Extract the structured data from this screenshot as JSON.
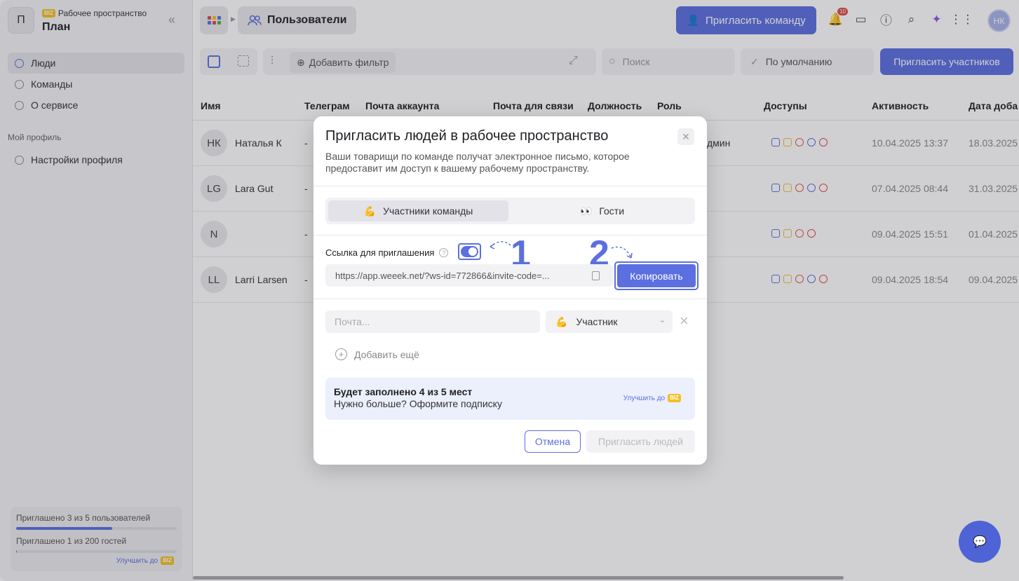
{
  "sidebar": {
    "workspace_avatar": "П",
    "workspace_badge": "BIZ",
    "workspace_label": "Рабочее пространство",
    "workspace_name": "План",
    "items": [
      {
        "label": "Люди",
        "icon": "smile-icon",
        "active": true
      },
      {
        "label": "Команды",
        "icon": "team-icon",
        "active": false
      },
      {
        "label": "О сервисе",
        "icon": "help-icon",
        "active": false
      }
    ],
    "section_title": "Мой профиль",
    "profile_item": "Настройки профиля",
    "usage": {
      "users_text": "Приглашено 3 из 5 пользователей",
      "users_fraction": 0.6,
      "guests_text": "Приглашено 1 из 200 гостей",
      "guests_fraction": 0.005,
      "upgrade_label": "Улучшить до",
      "upgrade_badge": "BIZ"
    }
  },
  "header": {
    "breadcrumb": "Пользователи",
    "invite_team": "Пригласить команду",
    "notifications_count": "10",
    "user_initials": "НК"
  },
  "toolbar": {
    "add_filter": "Добавить фильтр",
    "search_placeholder": "Поиск",
    "sort": "По умолчанию",
    "invite_members": "Пригласить участников"
  },
  "table": {
    "columns": [
      "Имя",
      "Телеграм",
      "Почта аккаунта",
      "Почта для связи",
      "Должность",
      "Роль",
      "Доступы",
      "Активность",
      "Дата доба"
    ],
    "rows": [
      {
        "initials": "НК",
        "name": "Наталья К",
        "telegram": "-",
        "role": "дмин",
        "activity": "10.04.2025 13:37",
        "added": "18.03.2025",
        "has_team": true
      },
      {
        "initials": "LG",
        "name": "Lara Gut",
        "telegram": "-",
        "role": "",
        "activity": "07.04.2025 08:44",
        "added": "31.03.2025",
        "has_team": true
      },
      {
        "initials": "N",
        "name": "",
        "telegram": "-",
        "role": "",
        "activity": "09.04.2025 15:51",
        "added": "01.04.2025",
        "has_team": false
      },
      {
        "initials": "LL",
        "name": "Larri Larsen",
        "telegram": "-",
        "role": "",
        "activity": "09.04.2025 18:54",
        "added": "09.04.2025",
        "has_team": true
      }
    ]
  },
  "modal": {
    "title": "Пригласить людей в рабочее пространство",
    "description": "Ваши товарищи по команде получат электронное письмо, которое предоставит им доступ к вашему рабочему пространству.",
    "tabs": [
      {
        "emoji": "💪",
        "label": "Участники команды",
        "active": true
      },
      {
        "emoji": "👀",
        "label": "Гости",
        "active": false
      }
    ],
    "link_label": "Ссылка для приглашения",
    "link_enabled": true,
    "link_value": "https://app.weeek.net/?ws-id=772866&invite-code=...",
    "copy_button": "Копировать",
    "annotation_1": "1",
    "annotation_2": "2",
    "email_placeholder": "Почта...",
    "role_emoji": "💪",
    "role_value": "Участник",
    "add_more": "Добавить ещё",
    "seats_title": "Будет заполнено 4 из 5 мест",
    "seats_subtitle": "Нужно больше? Оформите подписку",
    "upgrade_label": "Улучшить до",
    "upgrade_badge": "BIZ",
    "cancel_button": "Отмена",
    "invite_button": "Пригласить людей"
  },
  "colors": {
    "accent": "#5b6fe0",
    "access_task": "#5b6fe0",
    "access_doc": "#f2c025",
    "access_moon": "#e2574c",
    "access_team": "#5b6fe0",
    "access_time": "#e24a4a"
  }
}
